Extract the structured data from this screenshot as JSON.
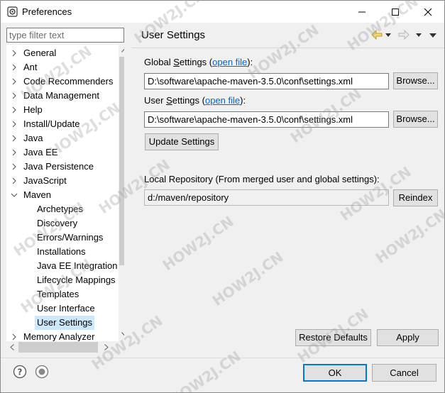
{
  "window": {
    "title": "Preferences"
  },
  "filter": {
    "placeholder": "type filter text"
  },
  "tree": {
    "items": [
      {
        "label": "General",
        "level": 0,
        "expanded": false
      },
      {
        "label": "Ant",
        "level": 0,
        "expanded": false
      },
      {
        "label": "Code Recommenders",
        "level": 0,
        "expanded": false
      },
      {
        "label": "Data Management",
        "level": 0,
        "expanded": false
      },
      {
        "label": "Help",
        "level": 0,
        "expanded": false
      },
      {
        "label": "Install/Update",
        "level": 0,
        "expanded": false
      },
      {
        "label": "Java",
        "level": 0,
        "expanded": false
      },
      {
        "label": "Java EE",
        "level": 0,
        "expanded": false
      },
      {
        "label": "Java Persistence",
        "level": 0,
        "expanded": false
      },
      {
        "label": "JavaScript",
        "level": 0,
        "expanded": false
      },
      {
        "label": "Maven",
        "level": 0,
        "expanded": true
      },
      {
        "label": "Archetypes",
        "level": 1
      },
      {
        "label": "Discovery",
        "level": 1
      },
      {
        "label": "Errors/Warnings",
        "level": 1
      },
      {
        "label": "Installations",
        "level": 1
      },
      {
        "label": "Java EE Integration",
        "level": 1
      },
      {
        "label": "Lifecycle Mappings",
        "level": 1
      },
      {
        "label": "Templates",
        "level": 1
      },
      {
        "label": "User Interface",
        "level": 1
      },
      {
        "label": "User Settings",
        "level": 1,
        "selected": true
      },
      {
        "label": "Memory Analyzer",
        "level": 0,
        "expanded": false
      }
    ]
  },
  "page": {
    "title": "User Settings",
    "global_label_prefix": "Global ",
    "global_label_u": "S",
    "global_label_mid": "ettings (",
    "global_link": "open file",
    "global_label_suffix": "):",
    "global_path": "D:\\software\\apache-maven-3.5.0\\conf\\settings.xml",
    "browse1": "Browse...",
    "user_label_prefix": "User ",
    "user_label_u": "S",
    "user_label_mid": "ettings (",
    "user_link": "open file",
    "user_label_suffix": "):",
    "user_path": "D:\\software\\apache-maven-3.5.0\\conf\\settings.xml",
    "browse2": "Browse...",
    "update_settings": "Update Settings",
    "local_repo_label": "Local Repository (From merged user and global settings):",
    "local_repo_path": "d:/maven/repository",
    "reindex": "Reindex"
  },
  "buttons": {
    "restore_defaults": "Restore Defaults",
    "apply": "Apply",
    "ok": "OK",
    "cancel": "Cancel"
  },
  "icons": {
    "help": "help-icon",
    "import_export": "import-export-icon",
    "back": "back-arrow-icon",
    "forward": "forward-arrow-icon",
    "menu": "view-menu-icon"
  },
  "watermark": {
    "text": "HOW2J.CN"
  }
}
